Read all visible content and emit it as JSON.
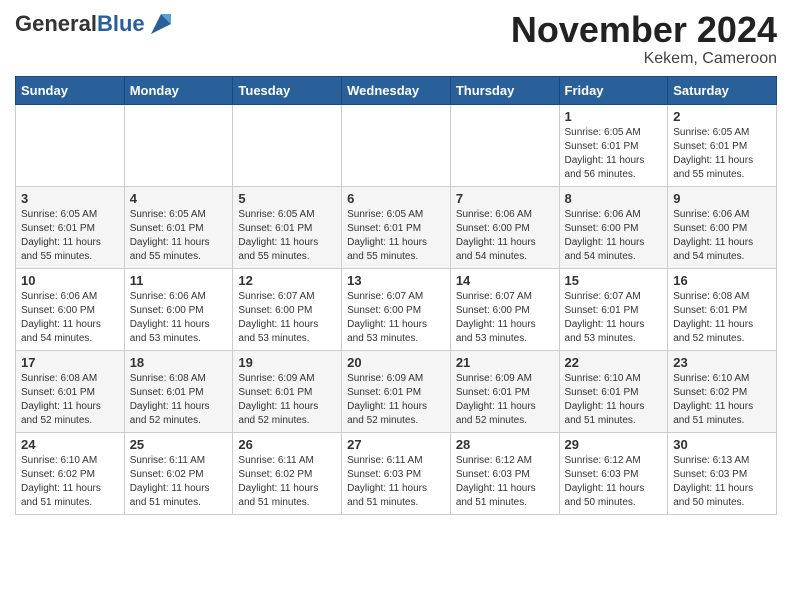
{
  "header": {
    "logo_general": "General",
    "logo_blue": "Blue",
    "month_title": "November 2024",
    "location": "Kekem, Cameroon"
  },
  "days_of_week": [
    "Sunday",
    "Monday",
    "Tuesday",
    "Wednesday",
    "Thursday",
    "Friday",
    "Saturday"
  ],
  "weeks": [
    [
      {
        "day": "",
        "info": ""
      },
      {
        "day": "",
        "info": ""
      },
      {
        "day": "",
        "info": ""
      },
      {
        "day": "",
        "info": ""
      },
      {
        "day": "",
        "info": ""
      },
      {
        "day": "1",
        "info": "Sunrise: 6:05 AM\nSunset: 6:01 PM\nDaylight: 11 hours\nand 56 minutes."
      },
      {
        "day": "2",
        "info": "Sunrise: 6:05 AM\nSunset: 6:01 PM\nDaylight: 11 hours\nand 55 minutes."
      }
    ],
    [
      {
        "day": "3",
        "info": "Sunrise: 6:05 AM\nSunset: 6:01 PM\nDaylight: 11 hours\nand 55 minutes."
      },
      {
        "day": "4",
        "info": "Sunrise: 6:05 AM\nSunset: 6:01 PM\nDaylight: 11 hours\nand 55 minutes."
      },
      {
        "day": "5",
        "info": "Sunrise: 6:05 AM\nSunset: 6:01 PM\nDaylight: 11 hours\nand 55 minutes."
      },
      {
        "day": "6",
        "info": "Sunrise: 6:05 AM\nSunset: 6:01 PM\nDaylight: 11 hours\nand 55 minutes."
      },
      {
        "day": "7",
        "info": "Sunrise: 6:06 AM\nSunset: 6:00 PM\nDaylight: 11 hours\nand 54 minutes."
      },
      {
        "day": "8",
        "info": "Sunrise: 6:06 AM\nSunset: 6:00 PM\nDaylight: 11 hours\nand 54 minutes."
      },
      {
        "day": "9",
        "info": "Sunrise: 6:06 AM\nSunset: 6:00 PM\nDaylight: 11 hours\nand 54 minutes."
      }
    ],
    [
      {
        "day": "10",
        "info": "Sunrise: 6:06 AM\nSunset: 6:00 PM\nDaylight: 11 hours\nand 54 minutes."
      },
      {
        "day": "11",
        "info": "Sunrise: 6:06 AM\nSunset: 6:00 PM\nDaylight: 11 hours\nand 53 minutes."
      },
      {
        "day": "12",
        "info": "Sunrise: 6:07 AM\nSunset: 6:00 PM\nDaylight: 11 hours\nand 53 minutes."
      },
      {
        "day": "13",
        "info": "Sunrise: 6:07 AM\nSunset: 6:00 PM\nDaylight: 11 hours\nand 53 minutes."
      },
      {
        "day": "14",
        "info": "Sunrise: 6:07 AM\nSunset: 6:00 PM\nDaylight: 11 hours\nand 53 minutes."
      },
      {
        "day": "15",
        "info": "Sunrise: 6:07 AM\nSunset: 6:01 PM\nDaylight: 11 hours\nand 53 minutes."
      },
      {
        "day": "16",
        "info": "Sunrise: 6:08 AM\nSunset: 6:01 PM\nDaylight: 11 hours\nand 52 minutes."
      }
    ],
    [
      {
        "day": "17",
        "info": "Sunrise: 6:08 AM\nSunset: 6:01 PM\nDaylight: 11 hours\nand 52 minutes."
      },
      {
        "day": "18",
        "info": "Sunrise: 6:08 AM\nSunset: 6:01 PM\nDaylight: 11 hours\nand 52 minutes."
      },
      {
        "day": "19",
        "info": "Sunrise: 6:09 AM\nSunset: 6:01 PM\nDaylight: 11 hours\nand 52 minutes."
      },
      {
        "day": "20",
        "info": "Sunrise: 6:09 AM\nSunset: 6:01 PM\nDaylight: 11 hours\nand 52 minutes."
      },
      {
        "day": "21",
        "info": "Sunrise: 6:09 AM\nSunset: 6:01 PM\nDaylight: 11 hours\nand 52 minutes."
      },
      {
        "day": "22",
        "info": "Sunrise: 6:10 AM\nSunset: 6:01 PM\nDaylight: 11 hours\nand 51 minutes."
      },
      {
        "day": "23",
        "info": "Sunrise: 6:10 AM\nSunset: 6:02 PM\nDaylight: 11 hours\nand 51 minutes."
      }
    ],
    [
      {
        "day": "24",
        "info": "Sunrise: 6:10 AM\nSunset: 6:02 PM\nDaylight: 11 hours\nand 51 minutes."
      },
      {
        "day": "25",
        "info": "Sunrise: 6:11 AM\nSunset: 6:02 PM\nDaylight: 11 hours\nand 51 minutes."
      },
      {
        "day": "26",
        "info": "Sunrise: 6:11 AM\nSunset: 6:02 PM\nDaylight: 11 hours\nand 51 minutes."
      },
      {
        "day": "27",
        "info": "Sunrise: 6:11 AM\nSunset: 6:03 PM\nDaylight: 11 hours\nand 51 minutes."
      },
      {
        "day": "28",
        "info": "Sunrise: 6:12 AM\nSunset: 6:03 PM\nDaylight: 11 hours\nand 51 minutes."
      },
      {
        "day": "29",
        "info": "Sunrise: 6:12 AM\nSunset: 6:03 PM\nDaylight: 11 hours\nand 50 minutes."
      },
      {
        "day": "30",
        "info": "Sunrise: 6:13 AM\nSunset: 6:03 PM\nDaylight: 11 hours\nand 50 minutes."
      }
    ]
  ]
}
